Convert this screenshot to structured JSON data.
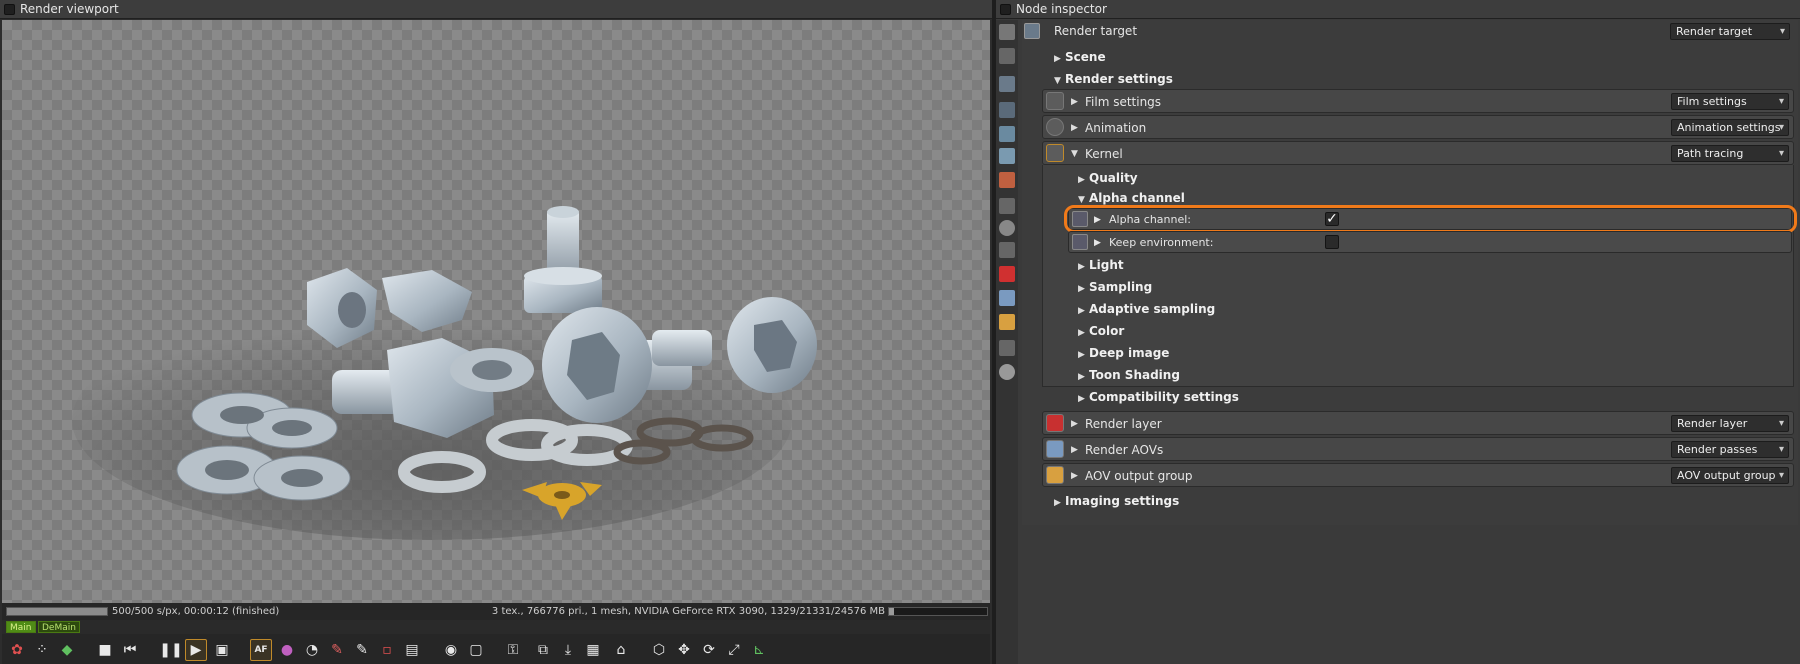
{
  "viewport": {
    "title": "Render viewport",
    "status_left": "500/500 s/px, 00:00:12 (finished)",
    "status_right": "3 tex., 766776 pri., 1 mesh, NVIDIA GeForce RTX 3090, 1329/21331/24576 MB",
    "progress": 1.0,
    "memory_fraction": 0.054,
    "tabs": [
      "Main",
      "DeMain"
    ],
    "toolbar_icons": [
      "clay-mode-icon",
      "region-icon",
      "color-icon",
      "stop-icon",
      "restart-icon",
      "pause-icon",
      "start-icon",
      "display-icon",
      "af-icon",
      "picker-icon",
      "focus-picker-icon",
      "white-balance-picker-icon",
      "material-picker-icon",
      "object-picker-icon",
      "camera-target-icon",
      "render-region-icon",
      "film-region-icon",
      "lock-icon",
      "copy-icon",
      "save-icon",
      "cubes-icon",
      "move-icon",
      "rotate-icon",
      "zoom-icon",
      "gizmo-icon"
    ],
    "af_label": "AF"
  },
  "inspector": {
    "title": "Node inspector",
    "header_label": "Render target",
    "header_dropdown": "Render target",
    "sections": {
      "scene": "Scene",
      "render_settings": "Render settings",
      "imaging_settings": "Imaging settings"
    },
    "nodes": {
      "film": {
        "label": "Film settings",
        "dropdown": "Film settings"
      },
      "animation": {
        "label": "Animation",
        "dropdown": "Animation settings"
      },
      "kernel": {
        "label": "Kernel",
        "dropdown": "Path tracing"
      },
      "render_layer": {
        "label": "Render layer",
        "dropdown": "Render layer"
      },
      "render_aovs": {
        "label": "Render AOVs",
        "dropdown": "Render passes"
      },
      "aov_output": {
        "label": "AOV output group",
        "dropdown": "AOV output group"
      }
    },
    "kernel_groups": {
      "quality": "Quality",
      "alpha_channel": "Alpha channel",
      "light": "Light",
      "sampling": "Sampling",
      "adaptive_sampling": "Adaptive sampling",
      "color": "Color",
      "deep_image": "Deep image",
      "toon_shading": "Toon Shading",
      "compatibility": "Compatibility settings"
    },
    "attributes": {
      "alpha_channel": {
        "label": "Alpha channel:",
        "checked": true
      },
      "keep_environment": {
        "label": "Keep environment:",
        "checked": false
      }
    },
    "checkmark": "✓"
  },
  "colors": {
    "highlight": "#f07a1a",
    "tab_main": "#4f8c16"
  }
}
